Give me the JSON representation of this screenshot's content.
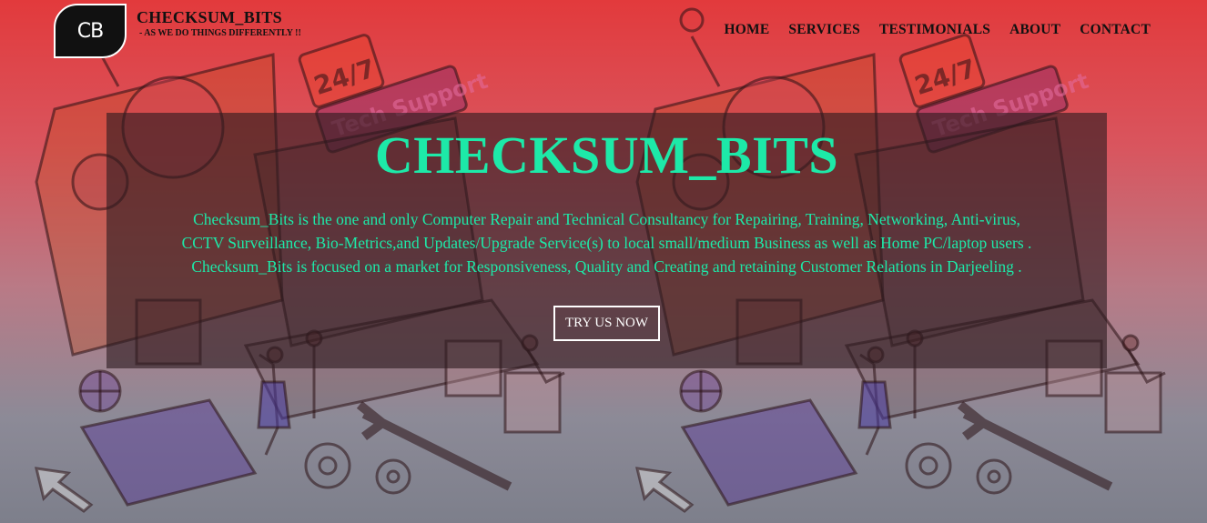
{
  "brand": {
    "logo_text": "CB",
    "name": "CHECKSUM_BITS",
    "tagline": "- AS WE DO THINGS DIFFERENTLY !!"
  },
  "nav": {
    "items": [
      {
        "label": "HOME"
      },
      {
        "label": "SERVICES"
      },
      {
        "label": "TESTIMONIALS"
      },
      {
        "label": "ABOUT"
      },
      {
        "label": "CONTACT"
      }
    ]
  },
  "hero": {
    "title": "CHECKSUM_BITS",
    "lines": [
      "Checksum_Bits is the one and only Computer Repair and Technical Consultancy for Repairing, Training, Networking, Anti-virus,",
      "CCTV Surveillance, Bio-Metrics,and Updates/Upgrade Service(s) to local small/medium Business as well as Home PC/laptop users .",
      "Checksum_Bits is focused on a market for Responsiveness, Quality and Creating and retaining Customer Relations in Darjeeling ."
    ],
    "cta_label": "TRY US NOW"
  },
  "background": {
    "sign_247": "24/7",
    "sign_support": "Tech Support"
  },
  "colors": {
    "accent": "#1de9a8",
    "header_top": "#e23a3c",
    "footer_bottom": "#7d7f8b"
  }
}
